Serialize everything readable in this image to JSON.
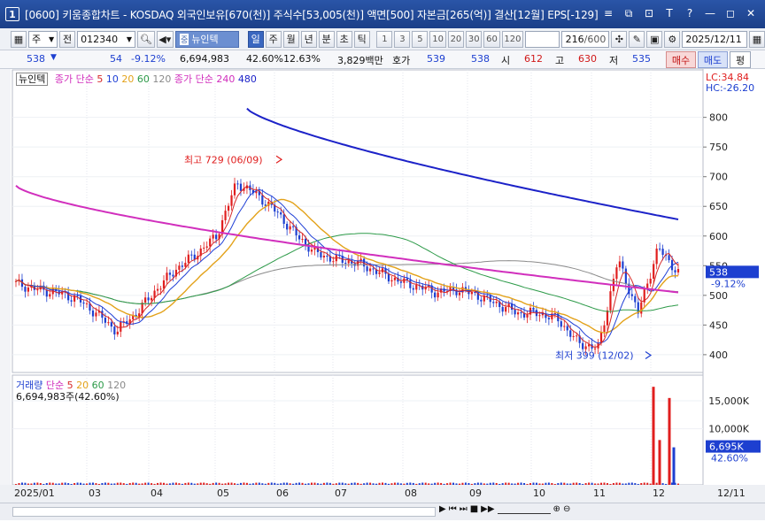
{
  "window": {
    "badge": "1",
    "title": "[0600] 키움종합차트 - KOSDAQ 외국인보유[670(천)] 주식수[53,005(천)] 액면[500] 자본금[265(억)] 결산[12월] EPS[-129]",
    "controls": [
      "≡",
      "⧉",
      "⊡",
      "T",
      "?",
      "—",
      "◻",
      "✕"
    ]
  },
  "toolbar": {
    "period_select": "주",
    "prev_label": "전",
    "code": "012340",
    "stock_name": "뉴인텍",
    "periods": [
      "일",
      "주",
      "월",
      "년",
      "분",
      "초",
      "틱"
    ],
    "active_period": "일",
    "intervals": [
      "1",
      "3",
      "5",
      "10",
      "20",
      "30",
      "60",
      "120"
    ],
    "count": "216",
    "count_total": "/600",
    "date": "2025/12/11"
  },
  "quote": {
    "price": "538",
    "change": "54",
    "change_pct": "-9.12%",
    "volume": "6,694,983",
    "volume_pct": "42.60%",
    "turnover_pct": "12.63%",
    "amount": "3,829백만",
    "hoga_label": "호가",
    "bid": "539",
    "ask": "538",
    "open_label": "시",
    "open": "612",
    "high_label": "고",
    "high": "630",
    "low_label": "저",
    "low": "535",
    "buy_label": "매수",
    "sell_label": "매도",
    "eval_label": "평"
  },
  "chart_data": [
    {
      "type": "candlestick",
      "legend": {
        "name": "뉴인텍",
        "ma_label": "종가 단순",
        "ma_periods": [
          "5",
          "10",
          "20",
          "60",
          "120"
        ],
        "ma2_label": "종가 단순 240",
        "ma2_value": "480"
      },
      "ylim": [
        370,
        880
      ],
      "y_ticks": [
        "800",
        "750",
        "700",
        "650",
        "600",
        "550",
        "500",
        "450",
        "400"
      ],
      "right_labels": {
        "lc": "LC:34.84",
        "hc": "HC:-26.20",
        "price": "538",
        "pct": "-9.12%"
      },
      "annotations": [
        {
          "text": "최고 729 (06/09)",
          "x": "06/09",
          "y": 729
        },
        {
          "text": "최저 399 (12/02)",
          "x": "12/02",
          "y": 399
        }
      ],
      "x_month_labels": [
        "2025/01",
        "03",
        "04",
        "05",
        "06",
        "07",
        "08",
        "09",
        "10",
        "11",
        "12",
        "12/11"
      ],
      "close_profile": [
        [
          "2025/01",
          520
        ],
        [
          "02",
          510
        ],
        [
          "03",
          505
        ],
        [
          "03/20",
          495
        ],
        [
          "04/01",
          470
        ],
        [
          "04/10",
          440
        ],
        [
          "04/20",
          470
        ],
        [
          "05/01",
          510
        ],
        [
          "05/15",
          545
        ],
        [
          "05/25",
          570
        ],
        [
          "06/01",
          600
        ],
        [
          "06/09",
          690
        ],
        [
          "06/15",
          670
        ],
        [
          "06/25",
          640
        ],
        [
          "07/01",
          600
        ],
        [
          "07/15",
          570
        ],
        [
          "07/25",
          560
        ],
        [
          "08/01",
          555
        ],
        [
          "08/15",
          540
        ],
        [
          "08/25",
          525
        ],
        [
          "09/01",
          515
        ],
        [
          "09/15",
          505
        ],
        [
          "09/25",
          510
        ],
        [
          "10/01",
          500
        ],
        [
          "10/15",
          485
        ],
        [
          "10/25",
          470
        ],
        [
          "11/01",
          470
        ],
        [
          "11/10",
          460
        ],
        [
          "11/20",
          420
        ],
        [
          "12/02",
          410
        ],
        [
          "12/05",
          560
        ],
        [
          "12/08",
          470
        ],
        [
          "12/10",
          580
        ],
        [
          "12/11",
          538
        ]
      ]
    },
    {
      "type": "bar",
      "legend": {
        "name": "거래량",
        "ma_label": "단순",
        "ma_periods": [
          "5",
          "20",
          "60",
          "120"
        ]
      },
      "volume_text": "6,694,983주(42.60%)",
      "ylim": [
        0,
        18000
      ],
      "y_ticks": [
        "15,000K",
        "10,000K"
      ],
      "right_labels": {
        "value": "6,695K",
        "pct": "42.60%"
      },
      "spikes": [
        {
          "x": "12/03",
          "value": 17500
        },
        {
          "x": "12/04",
          "value": 8000
        },
        {
          "x": "12/09",
          "value": 15500
        },
        {
          "x": "12/11",
          "value": 6695
        }
      ]
    }
  ],
  "colors": {
    "title_bg": "#1b3f88",
    "ma240": "#1c22c8",
    "ma5": "#d62828",
    "ma10": "#1f3fd6",
    "ma20": "#e3a21a",
    "ma60": "#2c9a48",
    "ma120": "#8a8a8a",
    "line_magenta": "#d12fbd",
    "up": "#e01e1e",
    "down": "#1d3fd0"
  },
  "scroll_icons": [
    "▶",
    "⏮",
    "⏭",
    "■",
    "▶▶",
    "—",
    "⊕",
    "⊖"
  ]
}
